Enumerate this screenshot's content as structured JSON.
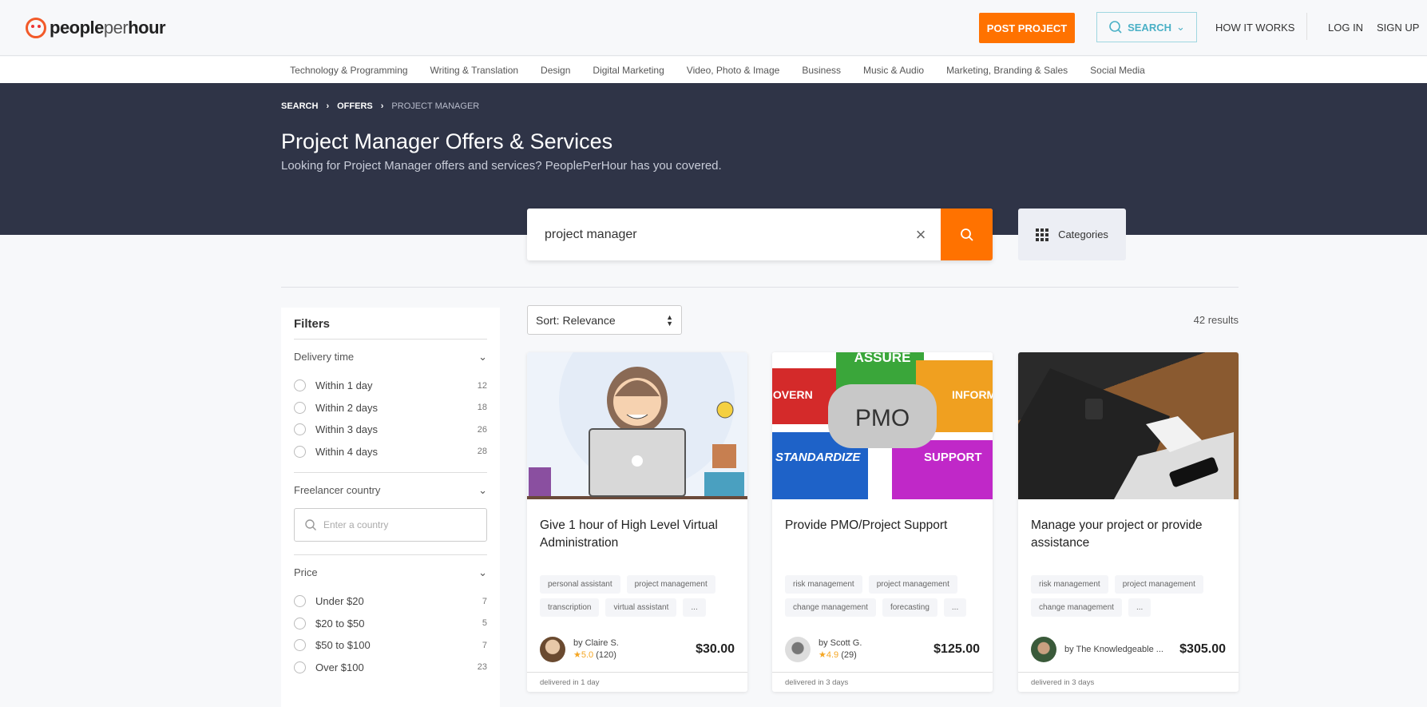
{
  "header": {
    "logo": "peopleperhour",
    "logo_parts": [
      "people",
      "per",
      "hour"
    ],
    "post_project": "POST PROJECT",
    "search": "SEARCH",
    "how_it_works": "HOW IT WORKS",
    "log_in": "LOG IN",
    "sign_up": "SIGN UP",
    "accent": "#ff7200"
  },
  "nav": [
    "Technology & Programming",
    "Writing & Translation",
    "Design",
    "Digital Marketing",
    "Video, Photo & Image",
    "Business",
    "Music & Audio",
    "Marketing, Branding & Sales",
    "Social Media"
  ],
  "breadcrumb": [
    "SEARCH",
    "OFFERS",
    "PROJECT MANAGER"
  ],
  "hero": {
    "title": "Project Manager Offers & Services",
    "subtitle": "Looking for Project Manager offers and services? PeoplePerHour has you covered."
  },
  "search": {
    "value": "project manager",
    "categories": "Categories"
  },
  "filters": {
    "title": "Filters",
    "delivery": {
      "label": "Delivery time",
      "options": [
        {
          "label": "Within 1 day",
          "count": "12"
        },
        {
          "label": "Within 2 days",
          "count": "18"
        },
        {
          "label": "Within 3 days",
          "count": "26"
        },
        {
          "label": "Within 4 days",
          "count": "28"
        }
      ]
    },
    "country": {
      "label": "Freelancer country",
      "placeholder": "Enter a country"
    },
    "price": {
      "label": "Price",
      "options": [
        {
          "label": "Under $20",
          "count": "7"
        },
        {
          "label": "$20 to $50",
          "count": "5"
        },
        {
          "label": "$50 to $100",
          "count": "7"
        },
        {
          "label": "Over $100",
          "count": "23"
        }
      ]
    }
  },
  "sort": "Sort: Relevance",
  "results": "42 results",
  "cards": [
    {
      "title": "Give 1 hour of High Level Virtual Administration",
      "tags": [
        "personal assistant",
        "project management",
        "transcription",
        "virtual assistant",
        "..."
      ],
      "by": "by Claire S.",
      "rating": "★5.0",
      "reviews": "(120)",
      "price": "$30.00",
      "delivery": "delivered in 1 day"
    },
    {
      "title": "Provide PMO/Project Support",
      "tags": [
        "risk management",
        "project management",
        "change management",
        "forecasting",
        "..."
      ],
      "by": "by Scott G.",
      "rating": "★4.9",
      "reviews": "(29)",
      "price": "$125.00",
      "delivery": "delivered in 3 days",
      "image_words": [
        "ASSURE",
        "GOVERN",
        "PMO",
        "INFORM",
        "STANDARDIZE",
        "SUPPORT"
      ]
    },
    {
      "title": "Manage your project or provide assistance",
      "tags": [
        "risk management",
        "project management",
        "change management",
        "..."
      ],
      "by": "by The Knowledgeable ...",
      "price": "$305.00",
      "delivery": "delivered in 3 days"
    }
  ]
}
